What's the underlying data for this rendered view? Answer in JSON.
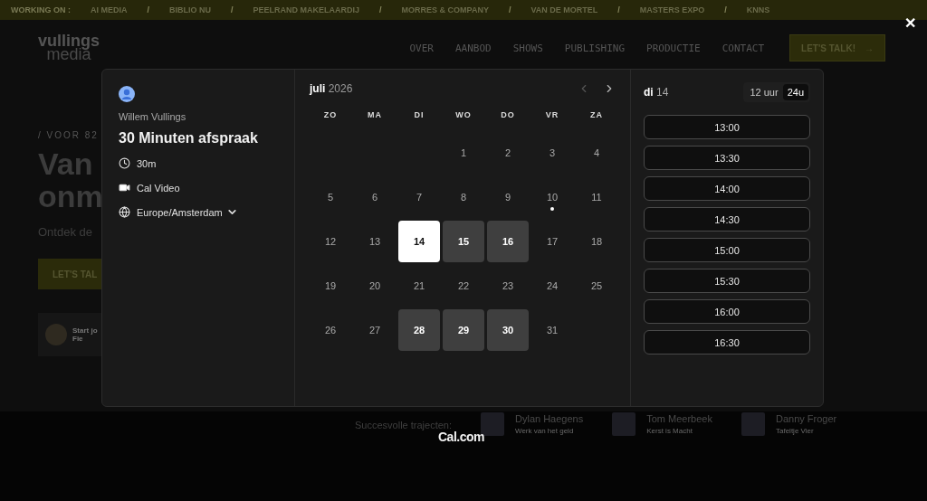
{
  "ticker": {
    "label": "WORKING ON :",
    "items": [
      "AI MEDIA",
      "BIBLIO NU",
      "PEELRAND MAKELAARDIJ",
      "MORRES & COMPANY",
      "VAN DE MORTEL",
      "MASTERS EXPO",
      "KNNS"
    ],
    "separator": "/"
  },
  "header": {
    "logo_top": "vullings",
    "logo_bottom": "media",
    "nav": [
      "OVER",
      "AANBOD",
      "SHOWS",
      "PUBLISHING",
      "PRODUCTIE",
      "CONTACT"
    ],
    "cta": "LET'S TALK!",
    "cta_arrow": "→"
  },
  "hero": {
    "eyebrow": "/ VOOR 82",
    "title_lines": [
      "Van",
      "onm"
    ],
    "subtitle": "Ontdek de",
    "button": "LET'S TAL",
    "card_line1": "Start jo",
    "card_line2": "Fie"
  },
  "testimonials": {
    "label": "Succesvolle trajecten:",
    "people": [
      {
        "name": "Dylan Haegens",
        "caption": "Werk van het geld"
      },
      {
        "name": "Tom Meerbeek",
        "caption": "Kerst is Macht"
      },
      {
        "name": "Danny Froger",
        "caption": "Tafeltje Vier"
      }
    ]
  },
  "close": "✕",
  "booking": {
    "host": "Willem Vullings",
    "event": "30 Minuten afspraak",
    "duration": "30m",
    "location": "Cal Video",
    "timezone": "Europe/Amsterdam",
    "month": "juli",
    "year": "2026",
    "weekdays": [
      "ZO",
      "MA",
      "DI",
      "WO",
      "DO",
      "VR",
      "ZA"
    ],
    "days": [
      {
        "label": "1",
        "kind": "plain",
        "selected": false
      },
      {
        "label": "2",
        "kind": "plain",
        "selected": false
      },
      {
        "label": "3",
        "kind": "plain",
        "selected": false
      },
      {
        "label": "4",
        "kind": "plain",
        "selected": false
      },
      {
        "label": "5",
        "kind": "plain",
        "selected": false
      },
      {
        "label": "6",
        "kind": "plain",
        "selected": false
      },
      {
        "label": "7",
        "kind": "plain",
        "selected": false
      },
      {
        "label": "8",
        "kind": "plain",
        "selected": false
      },
      {
        "label": "9",
        "kind": "plain",
        "selected": false
      },
      {
        "label": "10",
        "kind": "today",
        "selected": false
      },
      {
        "label": "11",
        "kind": "plain",
        "selected": false
      },
      {
        "label": "12",
        "kind": "plain",
        "selected": false
      },
      {
        "label": "13",
        "kind": "plain",
        "selected": false
      },
      {
        "label": "14",
        "kind": "available",
        "selected": true
      },
      {
        "label": "15",
        "kind": "available",
        "selected": false
      },
      {
        "label": "16",
        "kind": "available",
        "selected": false
      },
      {
        "label": "17",
        "kind": "plain",
        "selected": false
      },
      {
        "label": "18",
        "kind": "plain",
        "selected": false
      },
      {
        "label": "19",
        "kind": "plain",
        "selected": false
      },
      {
        "label": "20",
        "kind": "plain",
        "selected": false
      },
      {
        "label": "21",
        "kind": "plain",
        "selected": false
      },
      {
        "label": "22",
        "kind": "plain",
        "selected": false
      },
      {
        "label": "23",
        "kind": "plain",
        "selected": false
      },
      {
        "label": "24",
        "kind": "plain",
        "selected": false
      },
      {
        "label": "25",
        "kind": "plain",
        "selected": false
      },
      {
        "label": "26",
        "kind": "plain",
        "selected": false
      },
      {
        "label": "27",
        "kind": "plain",
        "selected": false
      },
      {
        "label": "28",
        "kind": "available",
        "selected": false
      },
      {
        "label": "29",
        "kind": "available",
        "selected": false
      },
      {
        "label": "30",
        "kind": "available",
        "selected": false
      },
      {
        "label": "31",
        "kind": "plain",
        "selected": false
      }
    ],
    "day_weekday": "di",
    "day_number": "14",
    "formats": [
      {
        "label": "12 uur",
        "selected": false
      },
      {
        "label": "24u",
        "selected": true
      }
    ],
    "slots": [
      "13:00",
      "13:30",
      "14:00",
      "14:30",
      "15:00",
      "15:30",
      "16:00",
      "16:30"
    ]
  },
  "brand": "Cal.com"
}
